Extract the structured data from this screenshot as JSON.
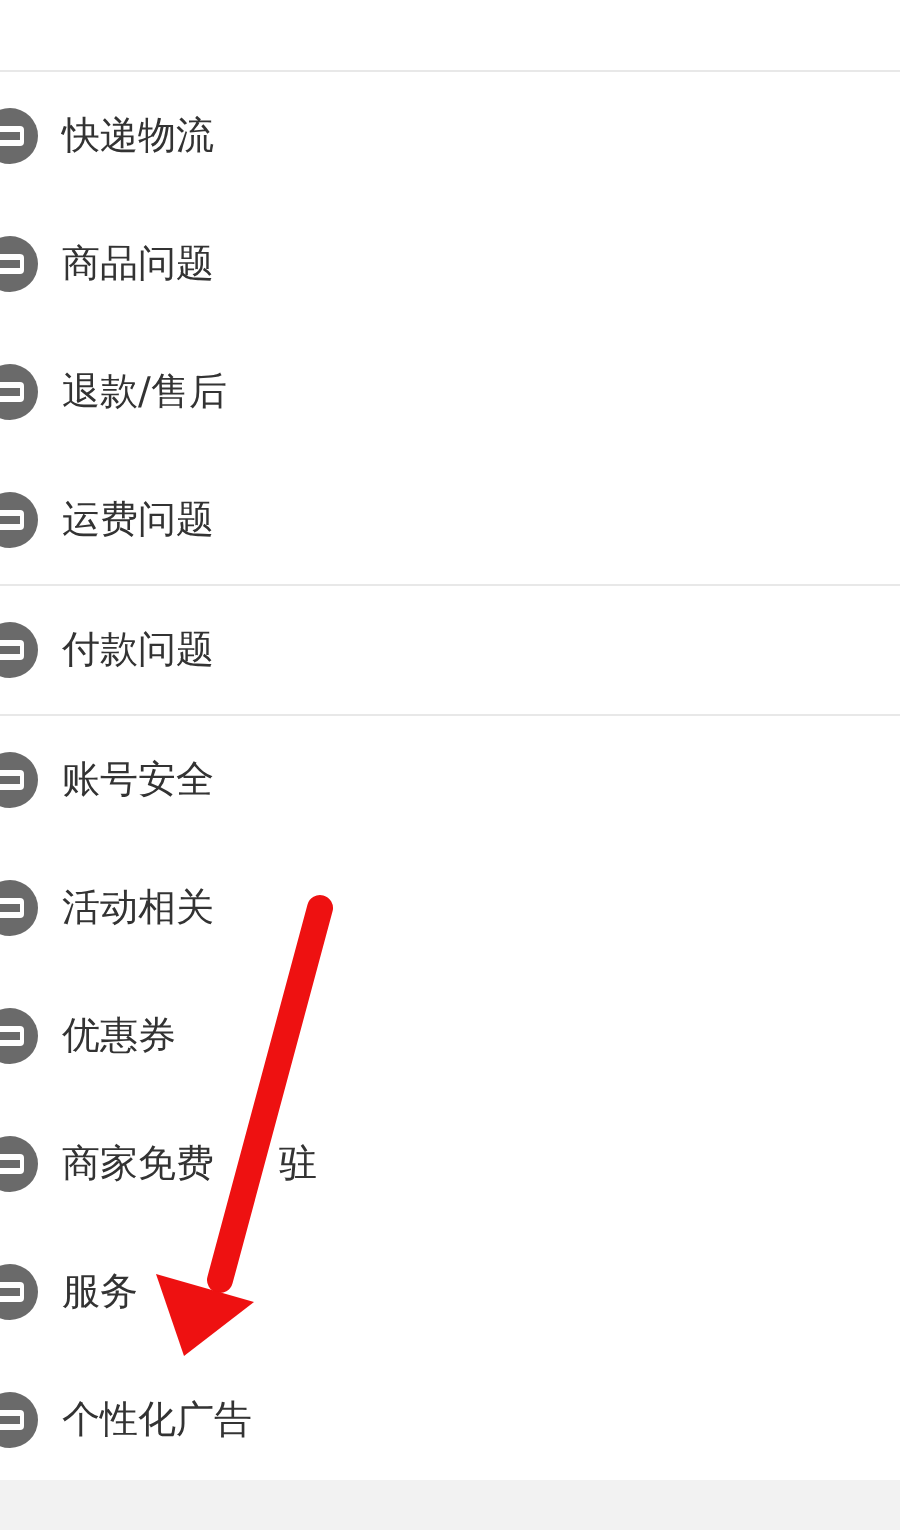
{
  "groups": [
    {
      "items": [
        {
          "texts": [
            "快递物流"
          ]
        },
        {
          "texts": [
            "商品问题"
          ]
        },
        {
          "texts": [
            "退款/售后"
          ]
        },
        {
          "texts": [
            "运费问题"
          ]
        }
      ]
    },
    {
      "items": [
        {
          "texts": [
            "付款问题"
          ]
        }
      ]
    },
    {
      "items": [
        {
          "texts": [
            "账号安全"
          ]
        },
        {
          "texts": [
            "活动相关"
          ]
        },
        {
          "texts": [
            "优惠券"
          ]
        },
        {
          "texts": [
            "商家免费",
            "驻"
          ]
        },
        {
          "texts": [
            "服务"
          ]
        },
        {
          "texts": [
            "个性化广告"
          ]
        }
      ]
    }
  ],
  "annotation": {
    "kind": "arrow"
  }
}
